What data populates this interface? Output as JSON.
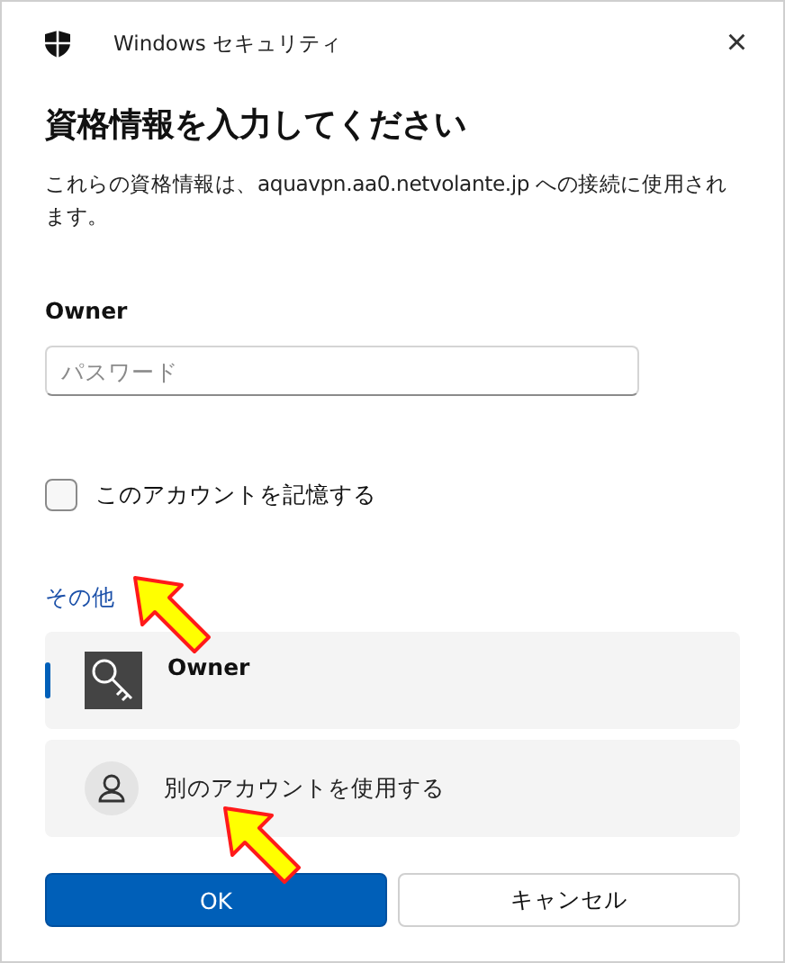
{
  "window": {
    "title": "Windows セキュリティ",
    "close": "×"
  },
  "heading": "資格情報を入力してください",
  "description": "これらの資格情報は、aquavpn.aa0.netvolante.jp への接続に使用されます。",
  "user": "Owner",
  "password": {
    "placeholder": "パスワード"
  },
  "remember": {
    "label": "このアカウントを記憶する",
    "checked": false
  },
  "more_link": "その他",
  "accounts": [
    {
      "kind": "key",
      "label": "Owner",
      "selected": true
    },
    {
      "kind": "person",
      "label": "別のアカウントを使用する",
      "selected": false
    }
  ],
  "buttons": [
    {
      "label": "OK",
      "primary": true
    },
    {
      "label": "キャンセル",
      "primary": false
    }
  ]
}
